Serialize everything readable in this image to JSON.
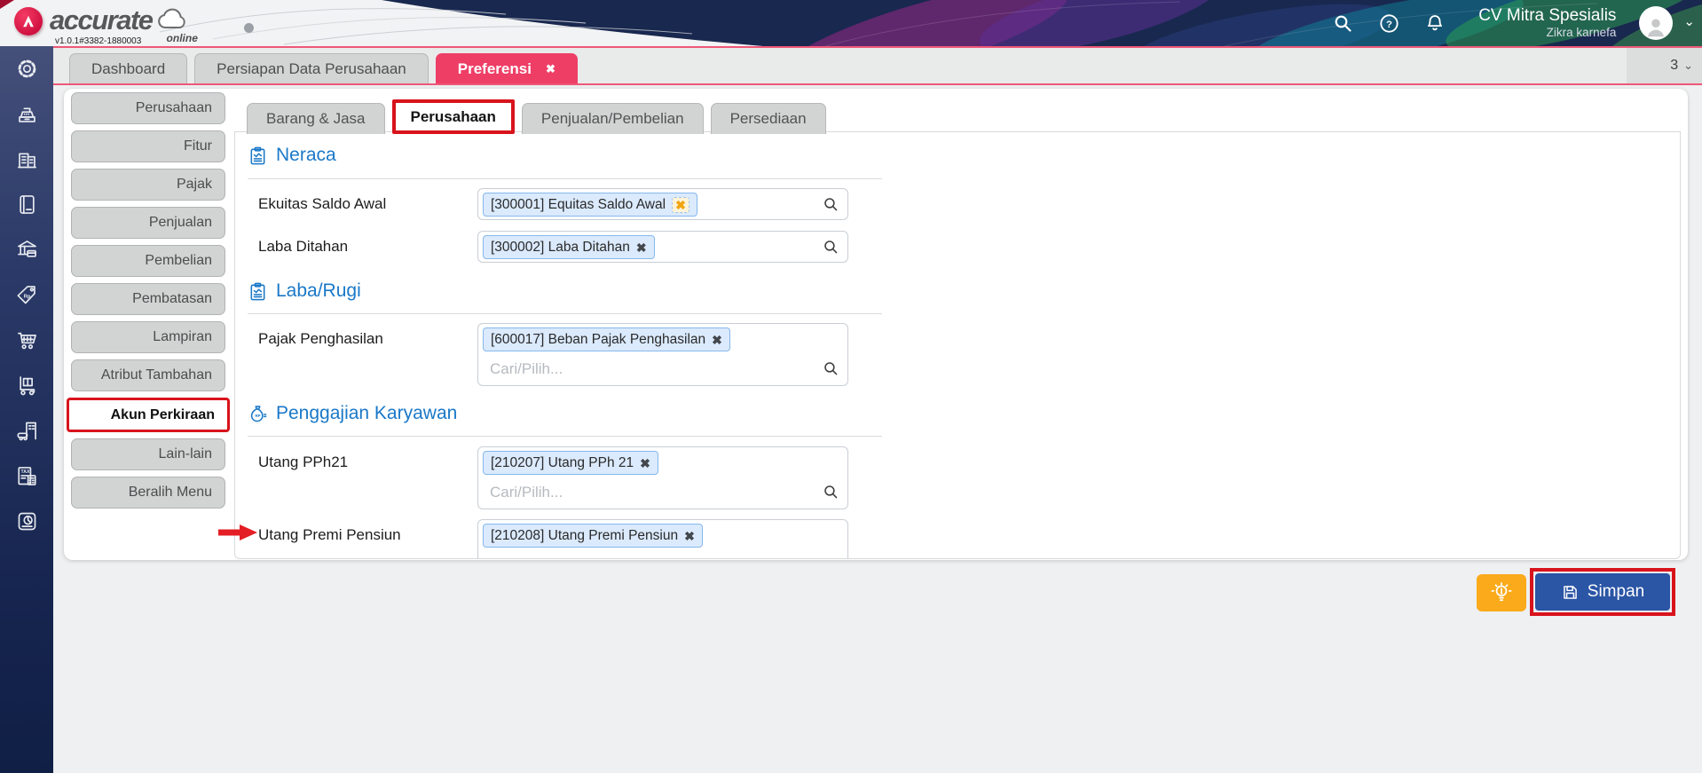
{
  "header": {
    "brand": "accurate",
    "brand_sub": "online",
    "version": "v1.0.1#3382-1880003",
    "company_name": "CV Mitra Spesialis",
    "user_name": "Zikra karnefa"
  },
  "glyphs": {
    "close": "✖",
    "chevron_down": "⌄"
  },
  "window_tabs": {
    "items": [
      {
        "label": "Dashboard"
      },
      {
        "label": "Persiapan Data Perusahaan"
      },
      {
        "label": "Preferensi",
        "active": true,
        "closable": true
      }
    ],
    "tab_count": "3"
  },
  "sidebar": {
    "icons": [
      "settings",
      "cash-register",
      "company",
      "journal",
      "bank-payment",
      "price-tag-rp",
      "purchase-cart",
      "inventory-trolley",
      "fixed-asset",
      "tax",
      "report"
    ]
  },
  "menu": {
    "items": [
      {
        "label": "Perusahaan"
      },
      {
        "label": "Fitur"
      },
      {
        "label": "Pajak"
      },
      {
        "label": "Penjualan"
      },
      {
        "label": "Pembelian"
      },
      {
        "label": "Pembatasan"
      },
      {
        "label": "Lampiran"
      },
      {
        "label": "Atribut Tambahan"
      },
      {
        "label": "Akun Perkiraan",
        "active": true
      },
      {
        "label": "Lain-lain"
      },
      {
        "label": "Beralih Menu"
      }
    ]
  },
  "preferences": {
    "tabs": [
      {
        "label": "Barang & Jasa"
      },
      {
        "label": "Perusahaan",
        "active": true
      },
      {
        "label": "Penjualan/Pembelian"
      },
      {
        "label": "Persediaan"
      }
    ],
    "sections": [
      {
        "title": "Neraca"
      },
      {
        "title": "Laba/Rugi"
      },
      {
        "title": "Penggajian Karyawan"
      }
    ],
    "fields": {
      "ekuitas": {
        "label": "Ekuitas Saldo Awal",
        "chip": "[300001] Equitas Saldo Awal"
      },
      "laba_ditahan": {
        "label": "Laba Ditahan",
        "chip": "[300002] Laba Ditahan"
      },
      "pajak": {
        "label": "Pajak Penghasilan",
        "chip": "[600017] Beban Pajak Penghasilan",
        "placeholder": "Cari/Pilih..."
      },
      "utang_pph21": {
        "label": "Utang PPh21",
        "chip": "[210207] Utang PPh 21",
        "placeholder": "Cari/Pilih..."
      },
      "utang_premi": {
        "label": "Utang Premi Pensiun",
        "chip": "[210208] Utang Premi Pensiun"
      }
    }
  },
  "footer": {
    "save_label": "Simpan"
  },
  "colors": {
    "header_navy": "#19284f",
    "active_tab_red": "#ee3e66",
    "annotation_red": "#d8131c",
    "primary_blue": "#1a78c8",
    "save_blue": "#2b55a5",
    "hint_orange": "#fbaa1b",
    "chip_bg": "#dbeafd",
    "chip_border": "#86b8ec",
    "close_orange": "#f1a40e"
  }
}
